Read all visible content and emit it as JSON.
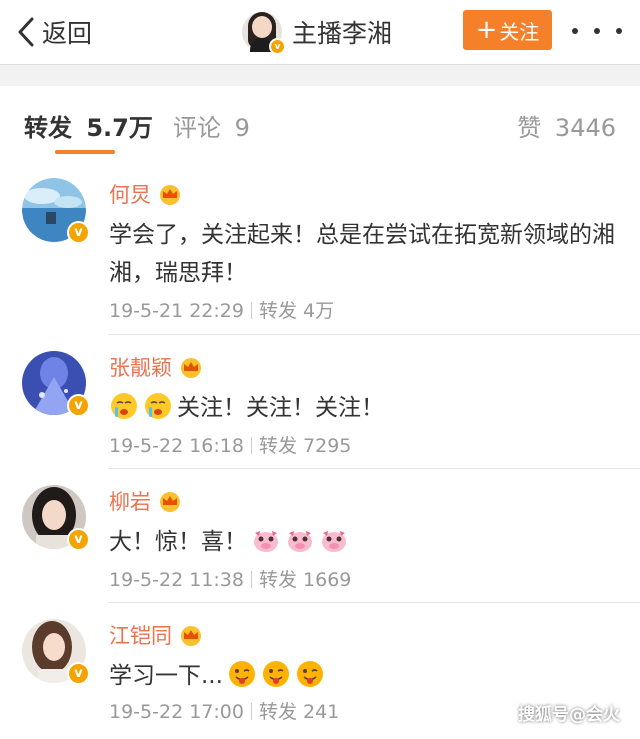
{
  "nav": {
    "back_label": "返回",
    "title": "主播李湘",
    "follow_label": "关注",
    "more_icon": "more-icon"
  },
  "tabs": {
    "repost_label": "转发",
    "repost_count": "5.7万",
    "comment_label": "评论",
    "comment_count": "9",
    "like_label": "赞",
    "like_count": "3446"
  },
  "colors": {
    "accent": "#f6802a",
    "name": "#eb7350",
    "verified_badge": "#f5a300"
  },
  "reposts": [
    {
      "name": "何炅",
      "text": "学会了，关注起来！总是在尝试在拓宽新领域的湘湘，瑞思拜！",
      "date": "19-5-21 22:29",
      "repost_label": "转发",
      "repost_count": "4万"
    },
    {
      "name": "张靓颖",
      "text": "关注！关注！关注！",
      "date": "19-5-22 16:18",
      "repost_label": "转发",
      "repost_count": "7295"
    },
    {
      "name": "柳岩",
      "text": "大！惊！喜！",
      "date": "19-5-22 11:38",
      "repost_label": "转发",
      "repost_count": "1669"
    },
    {
      "name": "江铠同",
      "text": "学习一下...",
      "date": "19-5-22 17:00",
      "repost_label": "转发",
      "repost_count": "241"
    }
  ],
  "watermark": "搜狐号@会火"
}
